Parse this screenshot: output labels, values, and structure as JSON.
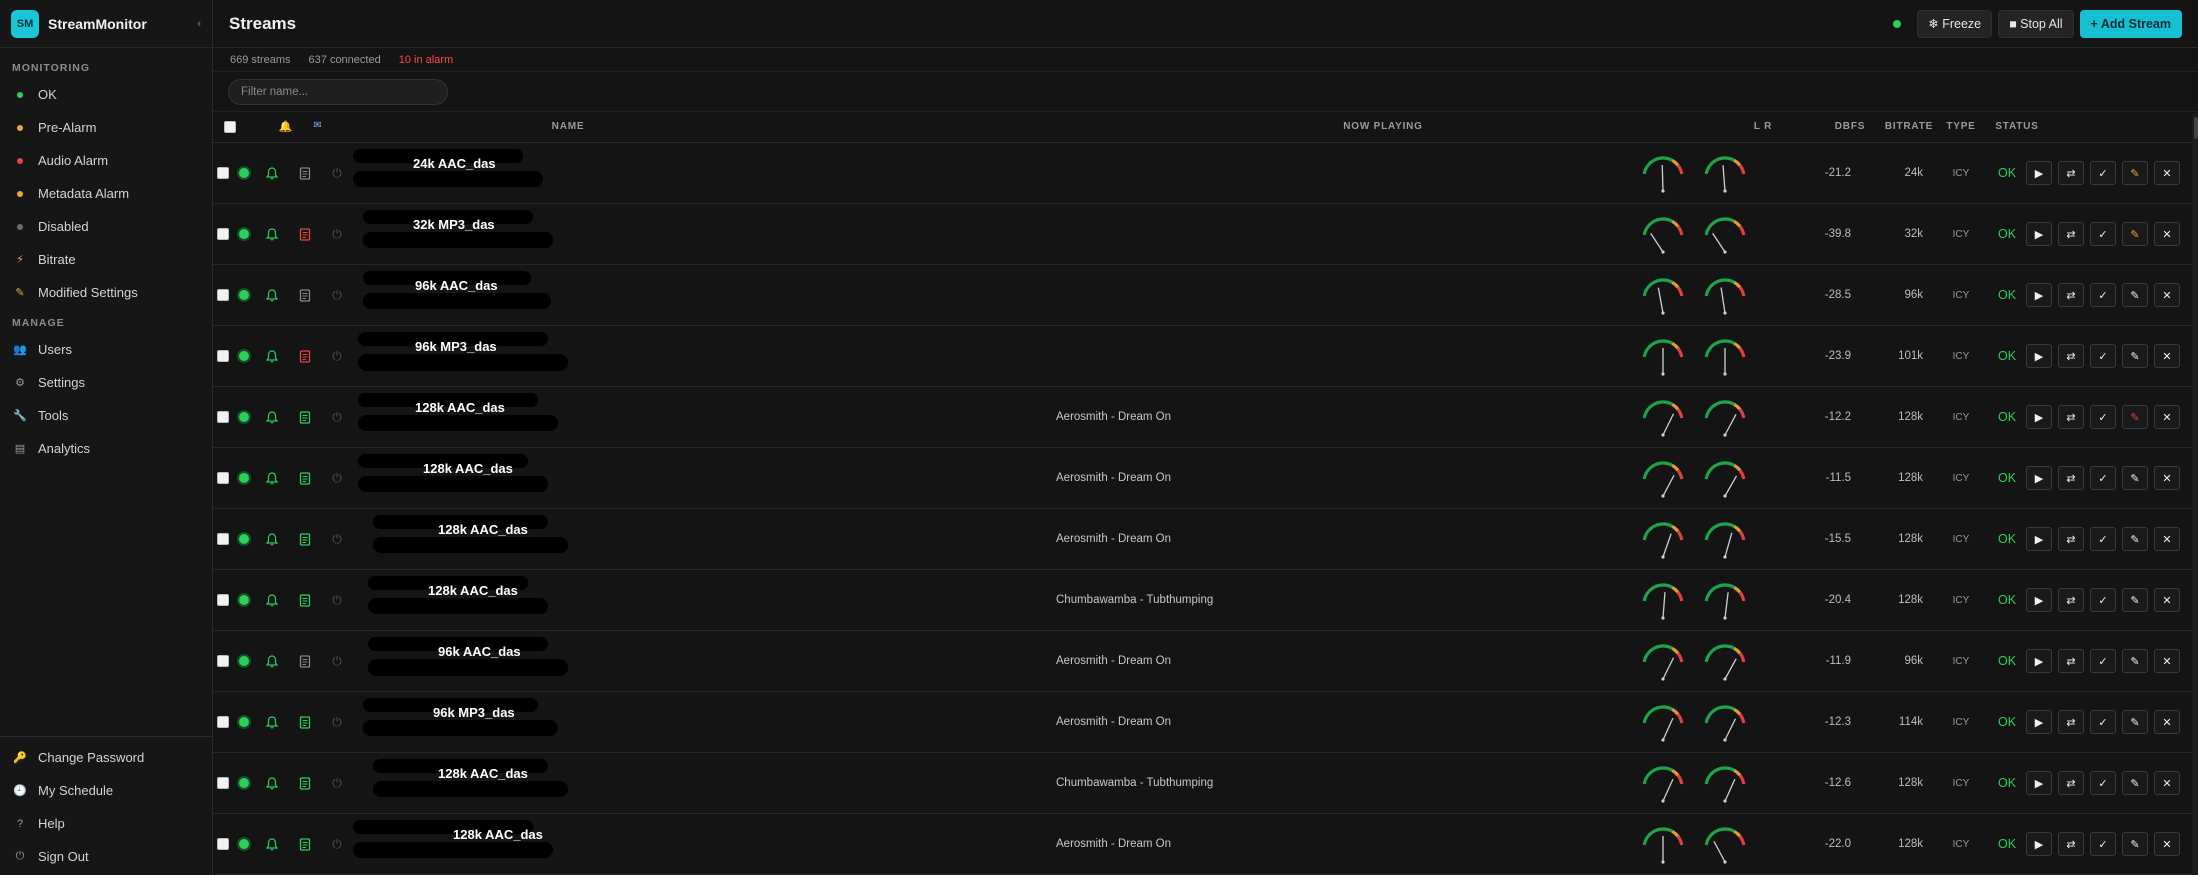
{
  "brand": {
    "logo_text": "SM",
    "name": "StreamMonitor",
    "collapse_icon": "chevron-left-icon"
  },
  "sidebar": {
    "monitoring_heading": "MONITORING",
    "monitoring_items": [
      {
        "label": "OK",
        "icon": "dot",
        "color": "#2bd05a"
      },
      {
        "label": "Pre-Alarm",
        "icon": "dot",
        "color": "#f0a63a"
      },
      {
        "label": "Audio Alarm",
        "icon": "dot",
        "color": "#e84545"
      },
      {
        "label": "Metadata Alarm",
        "icon": "dot",
        "color": "#f0a63a"
      },
      {
        "label": "Disabled",
        "icon": "dot",
        "color": "#6a6a6a"
      },
      {
        "label": "Bitrate",
        "icon": "lightning-icon",
        "color": "#f0a63a"
      },
      {
        "label": "Modified Settings",
        "icon": "pencil-icon",
        "color": "#f0a63a"
      }
    ],
    "manage_heading": "MANAGE",
    "manage_items": [
      {
        "label": "Users",
        "icon": "users-icon"
      },
      {
        "label": "Settings",
        "icon": "gear-icon"
      },
      {
        "label": "Tools",
        "icon": "wrench-icon"
      },
      {
        "label": "Analytics",
        "icon": "bar-chart-icon"
      }
    ],
    "bottom_items": [
      {
        "label": "Change Password",
        "icon": "key-icon"
      },
      {
        "label": "My Schedule",
        "icon": "clock-icon"
      },
      {
        "label": "Help",
        "icon": "question-icon"
      },
      {
        "label": "Sign Out",
        "icon": "power-icon"
      }
    ]
  },
  "header": {
    "title": "Streams",
    "freeze_label": "❄ Freeze",
    "stop_all_label": "■ Stop All",
    "add_stream_label": "+ Add Stream"
  },
  "stats": {
    "streams": "669 streams",
    "connected": "637 connected",
    "alarm": "10 in alarm"
  },
  "filter": {
    "placeholder": "Filter name..."
  },
  "table": {
    "headers": {
      "name": "NAME",
      "now_playing": "NOW PLAYING",
      "lr": "L R",
      "dbfs": "DBFS",
      "bitrate": "BITRATE",
      "type": "TYPE",
      "status": "STATUS"
    },
    "header_icons": [
      "bell-icon",
      "mail-icon"
    ],
    "rows": [
      {
        "name": "24k AAC_das",
        "now_playing": "",
        "dbfs": "-21.2",
        "bitrate": "24k",
        "type": "ICY",
        "status": "OK",
        "meta_color": "#888888",
        "gauge_l": 0.48,
        "gauge_r": 0.45,
        "edit_color": "#f0a63a"
      },
      {
        "name": "32k MP3_das",
        "now_playing": "",
        "dbfs": "-39.8",
        "bitrate": "32k",
        "type": "ICY",
        "status": "OK",
        "meta_color": "#e84545",
        "gauge_l": 0.12,
        "gauge_r": 0.12,
        "edit_color": "#f0a63a"
      },
      {
        "name": "96k AAC_das",
        "now_playing": "",
        "dbfs": "-28.5",
        "bitrate": "96k",
        "type": "ICY",
        "status": "OK",
        "meta_color": "#888888",
        "gauge_l": 0.38,
        "gauge_r": 0.4,
        "edit_color": "#f0f0f0"
      },
      {
        "name": "96k MP3_das",
        "now_playing": "",
        "dbfs": "-23.9",
        "bitrate": "101k",
        "type": "ICY",
        "status": "OK",
        "meta_color": "#e84545",
        "gauge_l": 0.5,
        "gauge_r": 0.5,
        "edit_color": "#f0f0f0"
      },
      {
        "name": "128k AAC_das",
        "now_playing": "Aerosmith - Dream On",
        "dbfs": "-12.2",
        "bitrate": "128k",
        "type": "ICY",
        "status": "OK",
        "meta_color": "#2bd05a",
        "gauge_l": 0.8,
        "gauge_r": 0.82,
        "edit_color": "#e84545"
      },
      {
        "name": "128k AAC_das",
        "now_playing": "Aerosmith - Dream On",
        "dbfs": "-11.5",
        "bitrate": "128k",
        "type": "ICY",
        "status": "OK",
        "meta_color": "#2bd05a",
        "gauge_l": 0.82,
        "gauge_r": 0.84,
        "edit_color": "#f0f0f0"
      },
      {
        "name": "128k AAC_das",
        "now_playing": "Aerosmith - Dream On",
        "dbfs": "-15.5",
        "bitrate": "128k",
        "type": "ICY",
        "status": "OK",
        "meta_color": "#2bd05a",
        "gauge_l": 0.72,
        "gauge_r": 0.68,
        "edit_color": "#f0f0f0"
      },
      {
        "name": "128k AAC_das",
        "now_playing": "Chumbawamba - Tubthumping",
        "dbfs": "-20.4",
        "bitrate": "128k",
        "type": "ICY",
        "status": "OK",
        "meta_color": "#2bd05a",
        "gauge_l": 0.55,
        "gauge_r": 0.58,
        "edit_color": "#f0f0f0"
      },
      {
        "name": "96k AAC_das",
        "now_playing": "Aerosmith - Dream On",
        "dbfs": "-11.9",
        "bitrate": "96k",
        "type": "ICY",
        "status": "OK",
        "meta_color": "#888888",
        "gauge_l": 0.8,
        "gauge_r": 0.83,
        "edit_color": "#f0f0f0"
      },
      {
        "name": "96k MP3_das",
        "now_playing": "Aerosmith - Dream On",
        "dbfs": "-12.3",
        "bitrate": "114k",
        "type": "ICY",
        "status": "OK",
        "meta_color": "#2bd05a",
        "gauge_l": 0.78,
        "gauge_r": 0.8,
        "edit_color": "#f0f0f0"
      },
      {
        "name": "128k AAC_das",
        "now_playing": "Chumbawamba - Tubthumping",
        "dbfs": "-12.6",
        "bitrate": "128k",
        "type": "ICY",
        "status": "OK",
        "meta_color": "#2bd05a",
        "gauge_l": 0.78,
        "gauge_r": 0.78,
        "edit_color": "#f0f0f0"
      },
      {
        "name": "128k AAC_das",
        "now_playing": "Aerosmith - Dream On",
        "dbfs": "-22.0",
        "bitrate": "128k",
        "type": "ICY",
        "status": "OK",
        "meta_color": "#2bd05a",
        "gauge_l": 0.5,
        "gauge_r": 0.18,
        "edit_color": "#f0f0f0"
      }
    ],
    "row_actions": [
      {
        "label": "▶",
        "icon": "play-icon"
      },
      {
        "label": "⇄",
        "icon": "swap-icon"
      },
      {
        "label": "✓",
        "icon": "check-icon"
      },
      {
        "label": "✎",
        "icon": "edit-icon"
      },
      {
        "label": "✕",
        "icon": "close-icon"
      }
    ]
  }
}
